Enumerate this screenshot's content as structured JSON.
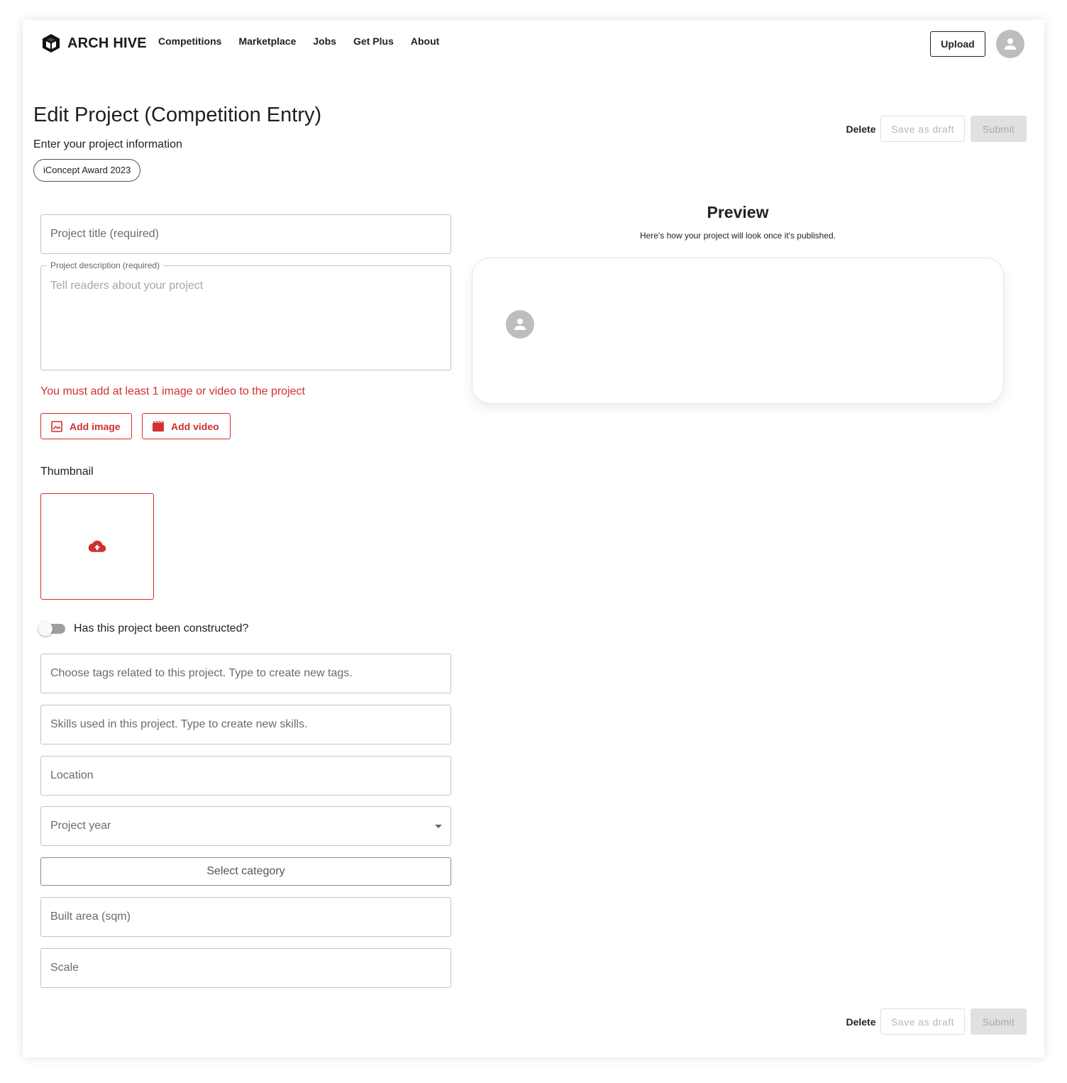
{
  "header": {
    "brand": "ARCH HIVE",
    "nav": [
      "Competitions",
      "Marketplace",
      "Jobs",
      "Get Plus",
      "About"
    ],
    "upload_label": "Upload"
  },
  "page": {
    "title": "Edit Project (Competition Entry)",
    "subtitle": "Enter your project information",
    "competition_chip": "iConcept Award 2023"
  },
  "actions": {
    "delete_label": "Delete",
    "draft_label": "Save as draft",
    "submit_label": "Submit"
  },
  "form": {
    "title_placeholder": "Project title (required)",
    "description_legend": "Project description (required)",
    "description_placeholder": "Tell readers about your project",
    "media_error": "You must add at least 1 image or video to the project",
    "add_image_label": "Add image",
    "add_video_label": "Add video",
    "thumbnail_label": "Thumbnail",
    "constructed_label": "Has this project been constructed?",
    "tags_placeholder": "Choose tags related to this project. Type to create new tags.",
    "skills_placeholder": "Skills used in this project. Type to create new skills.",
    "location_placeholder": "Location",
    "year_placeholder": "Project year",
    "category_label": "Select category",
    "built_area_placeholder": "Built area (sqm)",
    "scale_placeholder": "Scale"
  },
  "preview": {
    "title": "Preview",
    "subtitle": "Here's how your project will look once it's published."
  },
  "colors": {
    "error": "#d32f2f",
    "disabled_bg": "#e0e0e0",
    "avatar": "#bdbdbd"
  }
}
